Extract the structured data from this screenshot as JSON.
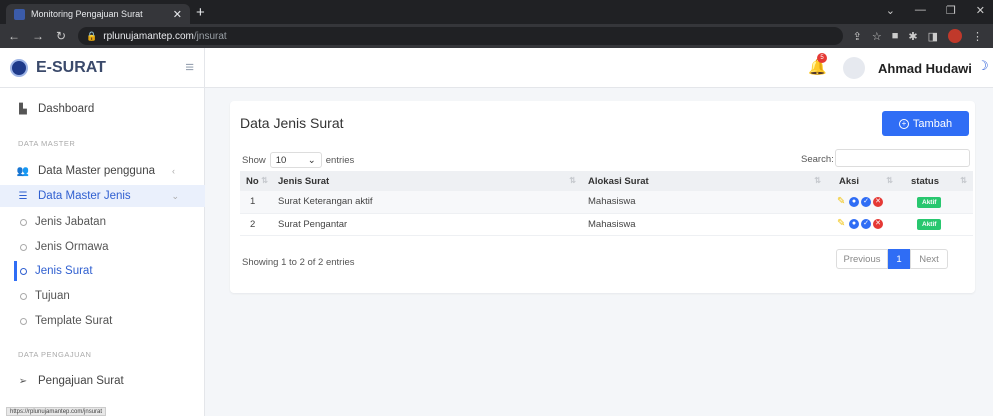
{
  "browser": {
    "tab_title": "Monitoring Pengajuan Surat",
    "url_host": "rplunujamantep.com",
    "url_path": "/jnsurat",
    "status_url": "https://rplunujamantep.com/jnsurat"
  },
  "brand": {
    "name": "E-SURAT"
  },
  "navbar": {
    "notif_count": "5",
    "user_name": "Ahmad Hudawi"
  },
  "sidebar": {
    "dashboard": "Dashboard",
    "section_master": "DATA MASTER",
    "master_pengguna": "Data Master pengguna",
    "master_jenis": "Data Master Jenis",
    "jenis_jabatan": "Jenis Jabatan",
    "jenis_ormawa": "Jenis Ormawa",
    "jenis_surat": "Jenis Surat",
    "tujuan": "Tujuan",
    "template_surat": "Template Surat",
    "section_pengajuan": "DATA PENGAJUAN",
    "pengajuan_surat": "Pengajuan Surat"
  },
  "card": {
    "title": "Data Jenis Surat",
    "add_button": "Tambah",
    "show_label": "Show",
    "length_value": "10",
    "entries_label": "entries",
    "search_label": "Search:",
    "search_value": "",
    "info": "Showing 1 to 2 of 2 entries",
    "prev": "Previous",
    "page": "1",
    "next": "Next"
  },
  "table": {
    "headers": [
      "No",
      "Jenis Surat",
      "Alokasi Surat",
      "Aksi",
      "status"
    ],
    "rows": [
      {
        "no": "1",
        "jenis": "Surat Keterangan aktif",
        "alokasi": "Mahasiswa",
        "status": "Aktif"
      },
      {
        "no": "2",
        "jenis": "Surat Pengantar",
        "alokasi": "Mahasiswa",
        "status": "Aktif"
      }
    ]
  },
  "colors": {
    "accent": "#2f6df5",
    "status_green": "#28c76f",
    "danger": "#e53935"
  }
}
